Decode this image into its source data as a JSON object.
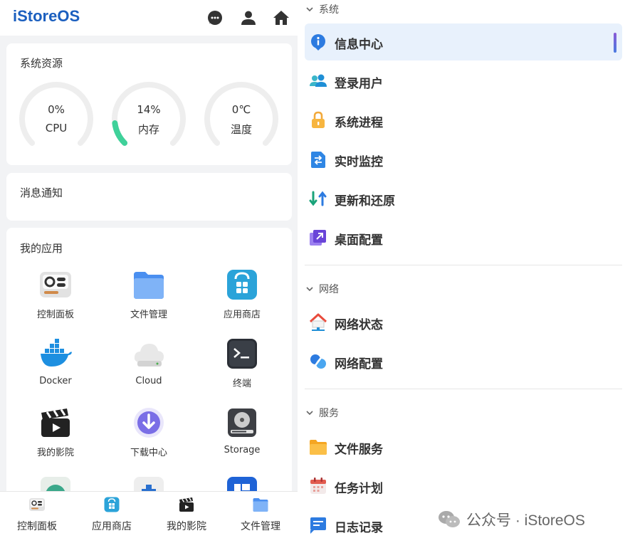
{
  "left": {
    "brand": "iStoreOS",
    "top_icons": [
      "chat-icon",
      "user-icon",
      "home-icon"
    ],
    "resources": {
      "title": "系统资源",
      "gauges": [
        {
          "value": "0%",
          "label": "CPU",
          "fraction": 0.0
        },
        {
          "value": "14%",
          "label": "内存",
          "fraction": 0.14
        },
        {
          "value": "0℃",
          "label": "温度",
          "fraction": 0.0
        }
      ]
    },
    "notifications": {
      "title": "消息通知"
    },
    "apps": {
      "title": "我的应用",
      "items": [
        {
          "label": "控制面板",
          "icon": "control-panel-icon"
        },
        {
          "label": "文件管理",
          "icon": "folder-icon"
        },
        {
          "label": "应用商店",
          "icon": "app-store-icon"
        },
        {
          "label": "Docker",
          "icon": "docker-icon"
        },
        {
          "label": "Cloud",
          "icon": "cloud-icon"
        },
        {
          "label": "终端",
          "icon": "terminal-icon"
        },
        {
          "label": "我的影院",
          "icon": "clapperboard-icon"
        },
        {
          "label": "下载中心",
          "icon": "download-icon"
        },
        {
          "label": "Storage",
          "icon": "storage-icon"
        }
      ]
    },
    "bottom_nav": [
      {
        "label": "控制面板",
        "icon": "control-panel-icon"
      },
      {
        "label": "应用商店",
        "icon": "app-store-icon"
      },
      {
        "label": "我的影院",
        "icon": "clapperboard-icon"
      },
      {
        "label": "文件管理",
        "icon": "folder-icon"
      }
    ]
  },
  "right": {
    "sections": [
      {
        "title": "系统",
        "items": [
          {
            "label": "信息中心",
            "icon": "info-icon",
            "active": true
          },
          {
            "label": "登录用户",
            "icon": "users-icon",
            "active": false
          },
          {
            "label": "系统进程",
            "icon": "lock-icon",
            "active": false
          },
          {
            "label": "实时监控",
            "icon": "monitor-icon",
            "active": false
          },
          {
            "label": "更新和还原",
            "icon": "refresh-icon",
            "active": false
          },
          {
            "label": "桌面配置",
            "icon": "desktop-config-icon",
            "active": false
          }
        ]
      },
      {
        "title": "网络",
        "items": [
          {
            "label": "网络状态",
            "icon": "network-house-icon",
            "active": false
          },
          {
            "label": "网络配置",
            "icon": "network-config-icon",
            "active": false
          }
        ]
      },
      {
        "title": "服务",
        "items": [
          {
            "label": "文件服务",
            "icon": "file-service-icon",
            "active": false
          },
          {
            "label": "任务计划",
            "icon": "calendar-icon",
            "active": false
          },
          {
            "label": "日志记录",
            "icon": "log-icon",
            "active": false
          }
        ]
      }
    ],
    "watermark": "公众号 · iStoreOS"
  },
  "colors": {
    "brand": "#1b5fbf",
    "gauge_track": "#eeeeee",
    "gauge_fill": "#3fd19a",
    "active_bg": "#e8f1fc"
  }
}
